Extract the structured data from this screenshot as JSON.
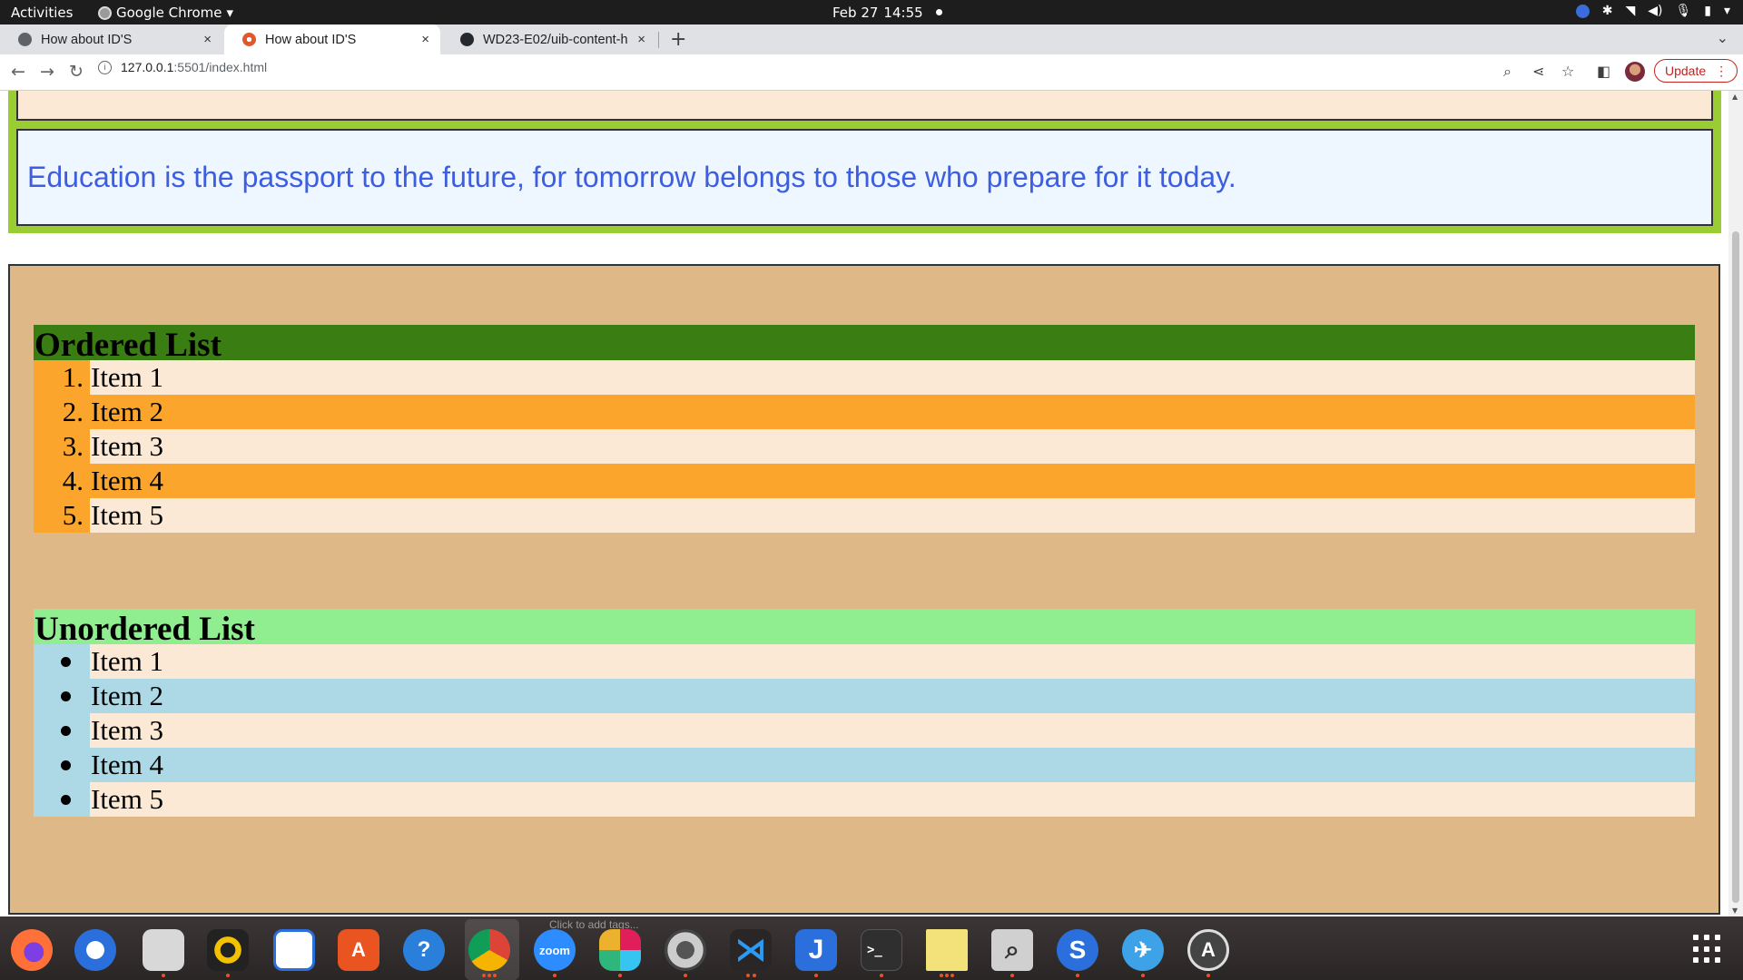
{
  "topbar": {
    "activities": "Activities",
    "app_name": "Google Chrome",
    "date": "Feb 27",
    "time": "14:55"
  },
  "tabs": [
    {
      "title": "How about ID'S",
      "close": "×"
    },
    {
      "title": "How about ID'S",
      "close": "×"
    },
    {
      "title": "WD23-E02/uib-content-h",
      "close": "×"
    }
  ],
  "toolbar": {
    "url_host": "127.0.0.1",
    "url_path": ":5501/index.html",
    "update_label": "Update"
  },
  "page": {
    "quote": "Education is the passport to the future, for tomorrow belongs to those who prepare for it today.",
    "ordered_heading": "Ordered List",
    "ordered_items": [
      {
        "marker": "1.",
        "text": "Item 1"
      },
      {
        "marker": "2.",
        "text": "Item 2"
      },
      {
        "marker": "3.",
        "text": "Item 3"
      },
      {
        "marker": "4.",
        "text": "Item 4"
      },
      {
        "marker": "5.",
        "text": "Item 5"
      }
    ],
    "unordered_heading": "Unordered List",
    "unordered_items": [
      {
        "text": "Item 1"
      },
      {
        "text": "Item 2"
      },
      {
        "text": "Item 3"
      },
      {
        "text": "Item 4"
      },
      {
        "text": "Item 5"
      }
    ]
  },
  "dock": {
    "hint": "Click to add tags...",
    "zoom_label": "zoom"
  },
  "colors": {
    "quote_text": "#3d5ee0",
    "ordered_heading_bg": "#3a7d12",
    "unordered_heading_bg": "#90ee90",
    "section_bg": "#deb887",
    "orange_stripe": "#fba52d",
    "blue_stripe": "#add8e6",
    "cream_stripe": "#fbe9d6",
    "frame_green": "#9acd32"
  }
}
